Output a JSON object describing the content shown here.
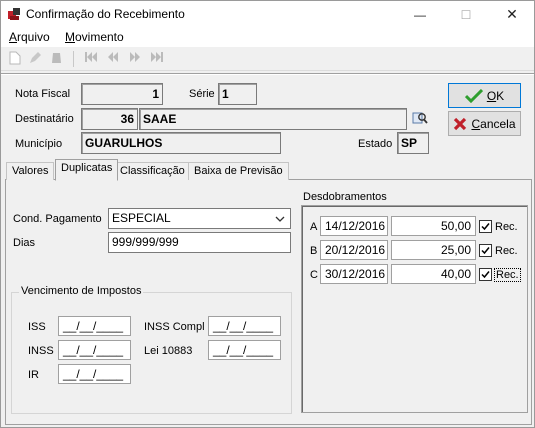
{
  "window": {
    "title": "Confirmação do Recebimento",
    "minimize_glyph": "—",
    "maximize_glyph": "☐",
    "close_glyph": "✕"
  },
  "menu": {
    "arquivo": {
      "accel": "A",
      "rest": "rquivo"
    },
    "movimento": {
      "accel": "M",
      "rest": "ovimento"
    }
  },
  "toolbar": {
    "icons": [
      "new-document-icon",
      "edit-icon",
      "delete-icon",
      "first-record-icon",
      "previous-record-icon",
      "next-record-icon",
      "last-record-icon"
    ]
  },
  "header": {
    "nota_fiscal_label": "Nota Fiscal",
    "nota_fiscal_value": "1",
    "serie_label": "Série",
    "serie_value": "1",
    "destinatario_label": "Destinatário",
    "destinatario_code": "36",
    "destinatario_name": "SAAE",
    "municipio_label": "Município",
    "municipio_value": "GUARULHOS",
    "estado_label": "Estado",
    "estado_value": "SP"
  },
  "buttons": {
    "ok_accel": "O",
    "ok_rest": "K",
    "cancel_accel": "C",
    "cancel_rest": "ancela"
  },
  "tabs": [
    "Valores",
    "Duplicatas",
    "Classificação",
    "Baixa de Previsão"
  ],
  "active_tab": "Duplicatas",
  "duplicatas": {
    "cond_pagamento_label": "Cond. Pagamento",
    "cond_pagamento_value": "ESPECIAL",
    "dias_label": "Dias",
    "dias_value": "999/999/999",
    "vencimento_title": "Vencimento de Impostos",
    "iss_label": "ISS",
    "iss_value": "__/__/____",
    "inss_label": "INSS",
    "inss_value": "__/__/____",
    "ir_label": "IR",
    "ir_value": "__/__/____",
    "inss_compl_label": "INSS Compl",
    "inss_compl_value": "__/__/____",
    "lei_label": "Lei 10883",
    "lei_value": "__/__/____",
    "desdobramentos_title": "Desdobramentos",
    "rows": [
      {
        "letter": "A",
        "date": "14/12/2016",
        "value": "50,00",
        "rec_label": "Rec.",
        "checked": true
      },
      {
        "letter": "B",
        "date": "20/12/2016",
        "value": "25,00",
        "rec_label": "Rec.",
        "checked": true
      },
      {
        "letter": "C",
        "date": "30/12/2016",
        "value": "40,00",
        "rec_label": "Rec.",
        "checked": true
      }
    ]
  },
  "colors": {
    "ok_check": "#2e9e2e",
    "cancel_x": "#c0202a",
    "app_icon": "#c0202a"
  }
}
